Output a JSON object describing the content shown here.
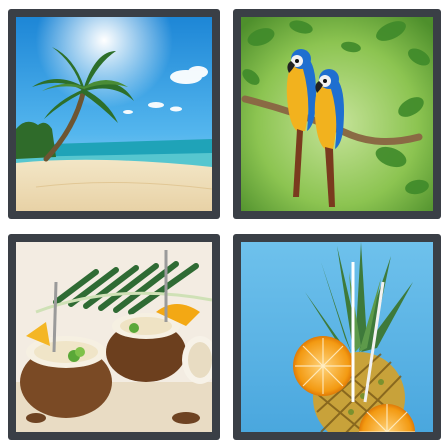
{
  "puzzle": {
    "tiles": [
      {
        "subject": "tropical-beach-with-palm-tree"
      },
      {
        "subject": "two-blue-and-yellow-macaws-on-branch"
      },
      {
        "subject": "coconut-drinks-on-sand"
      },
      {
        "subject": "pineapple-with-orange-slices-and-straws"
      }
    ]
  },
  "colors": {
    "frame": "#3a3f46",
    "sky": "#3fa8e6",
    "sand": "#eedcba",
    "sea": "#1fa3b8",
    "foliage_green": "#7fbf4a",
    "macaw_blue": "#1f6fd0",
    "macaw_yellow": "#f2b21e",
    "coconut_brown": "#7a4a25",
    "orange": "#f39a12",
    "pineapple_gold": "#c8a23a"
  }
}
